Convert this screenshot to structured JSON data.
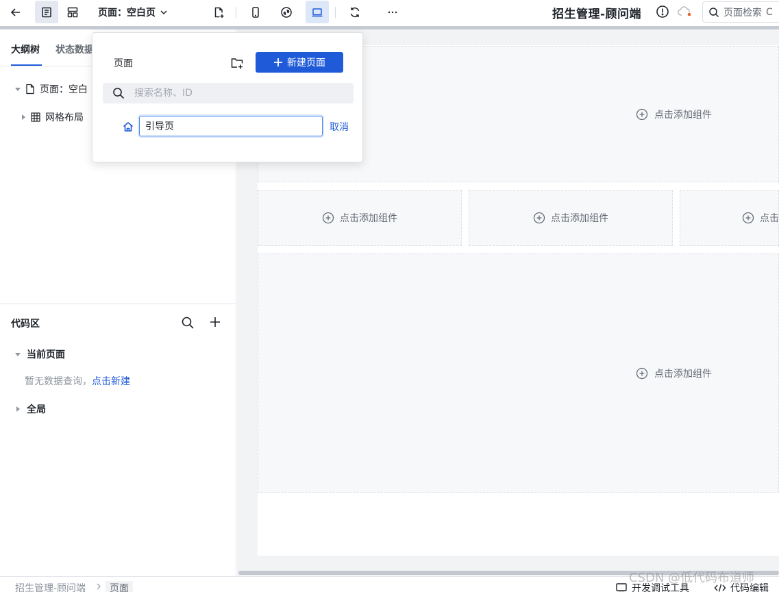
{
  "toolbar": {
    "page_dropdown_label": "页面：空白页",
    "app_title": "招生管理-顾问端",
    "search_label": "页面检索",
    "search_shortcut": "C"
  },
  "left_panel": {
    "tabs": [
      {
        "label": "大纲树",
        "active": true
      },
      {
        "label": "状态数据",
        "active": false
      }
    ],
    "tree": [
      {
        "label": "页面：空白",
        "icon": "page-icon",
        "expanded": true
      },
      {
        "label": "网格布局",
        "icon": "grid-icon",
        "expanded": false
      }
    ]
  },
  "code_area": {
    "title": "代码区",
    "groups": [
      {
        "label": "当前页面",
        "expanded": true
      },
      {
        "label": "全局",
        "expanded": false
      }
    ],
    "empty_text": "暂无数据查询，",
    "empty_link": "点击新建"
  },
  "canvas": {
    "slot_label": "点击添加组件"
  },
  "popover": {
    "title": "页面",
    "new_page_button": "新建页面",
    "search_placeholder": "搜索名称、ID",
    "new_page_input_value": "引导页",
    "cancel_label": "取消"
  },
  "statusbar": {
    "breadcrumb": [
      "招生管理-顾问端",
      "页面"
    ],
    "dev_tools_label": "开发调试工具",
    "code_editor_label": "代码编辑"
  },
  "watermark": "CSDN @低代码布道师",
  "colors": {
    "primary": "#1f5bd8",
    "canvas_bg": "#f2f3f5",
    "slot_bg": "#f7f8fa",
    "warning_dot": "#e8622c"
  }
}
